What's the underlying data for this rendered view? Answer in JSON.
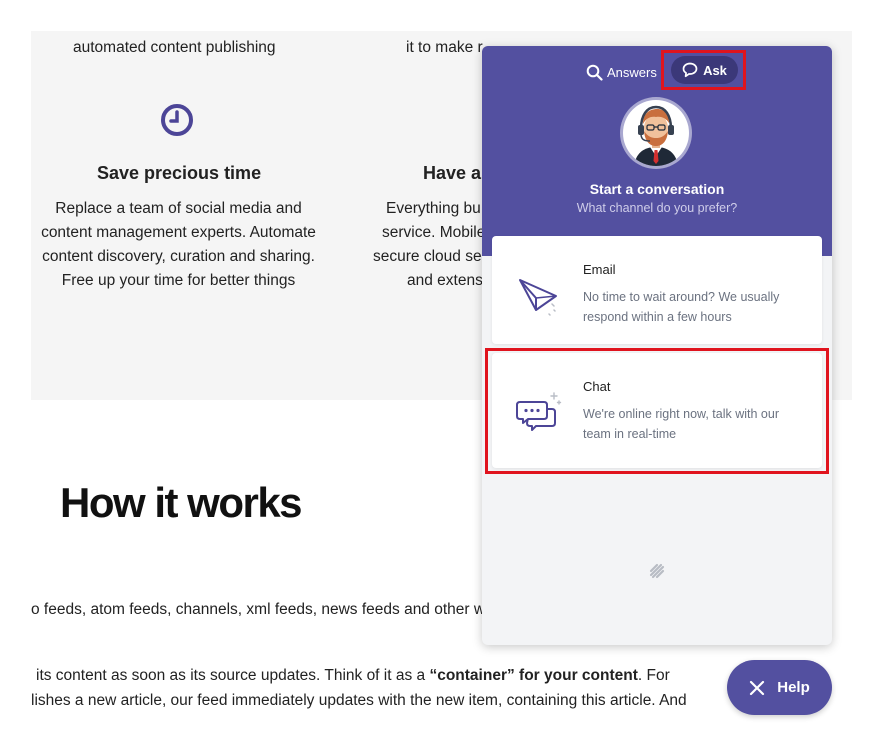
{
  "page": {
    "features": [
      {
        "top_fragment": "automated content publishing",
        "title": "Save precious time",
        "desc_lines": [
          "Replace a team of social media and",
          "content management experts. Automate",
          "content discovery, curation and sharing.",
          "Free up your time for better things"
        ],
        "icon": "clock-icon"
      },
      {
        "top_fragment": "it to make r",
        "title": "Have a",
        "desc_lines": [
          "Everything bu",
          "service. Mobile",
          "secure cloud se",
          "and extens"
        ]
      }
    ],
    "how_title": "How it works",
    "para1": "o feeds, atom feeds, channels,  xml feeds, news feeds and other w",
    "para2_prefix": "its content as soon as its source updates. Think of it as a ",
    "para2_bold": "“container” for your content",
    "para2_suffix": ".  For",
    "para3": "lishes a new article, our feed immediately updates with the new item, containing this article.  And"
  },
  "widget": {
    "tabs": {
      "answers": "Answers",
      "ask": "Ask"
    },
    "conversation": {
      "title": "Start a conversation",
      "subtitle": "What channel do you prefer?"
    },
    "channels": [
      {
        "title": "Email",
        "desc": "No time to wait around? We usually respond within a few hours",
        "icon": "paper-plane-icon"
      },
      {
        "title": "Chat",
        "desc": "We're online right now, talk with our team in real-time",
        "icon": "chat-bubbles-icon"
      }
    ],
    "accent": "#5350a0",
    "highlight": "#e0141e"
  },
  "help_button": {
    "label": "Help",
    "icon": "close-icon"
  }
}
